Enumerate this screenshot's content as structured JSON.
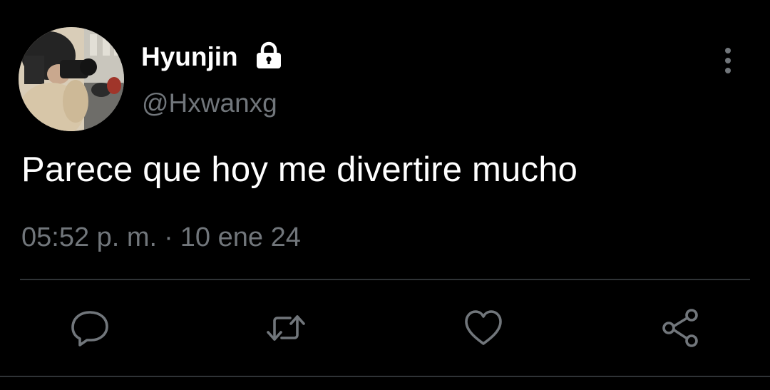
{
  "user": {
    "display_name": "Hyunjin",
    "handle": "@Hxwanxg",
    "protected_icon": "lock-icon"
  },
  "tweet": {
    "text": "Parece que hoy me divertire mucho",
    "time": "05:52 p. m.",
    "separator": "·",
    "date": "10 ene 24"
  },
  "actions": {
    "reply_icon": "reply-icon",
    "retweet_icon": "retweet-icon",
    "like_icon": "heart-icon",
    "share_icon": "share-icon"
  },
  "more_icon": "more-vertical-icon",
  "colors": {
    "background": "#000000",
    "primary_text": "#ffffff",
    "secondary_text": "#71767b",
    "divider": "#2f3336"
  }
}
